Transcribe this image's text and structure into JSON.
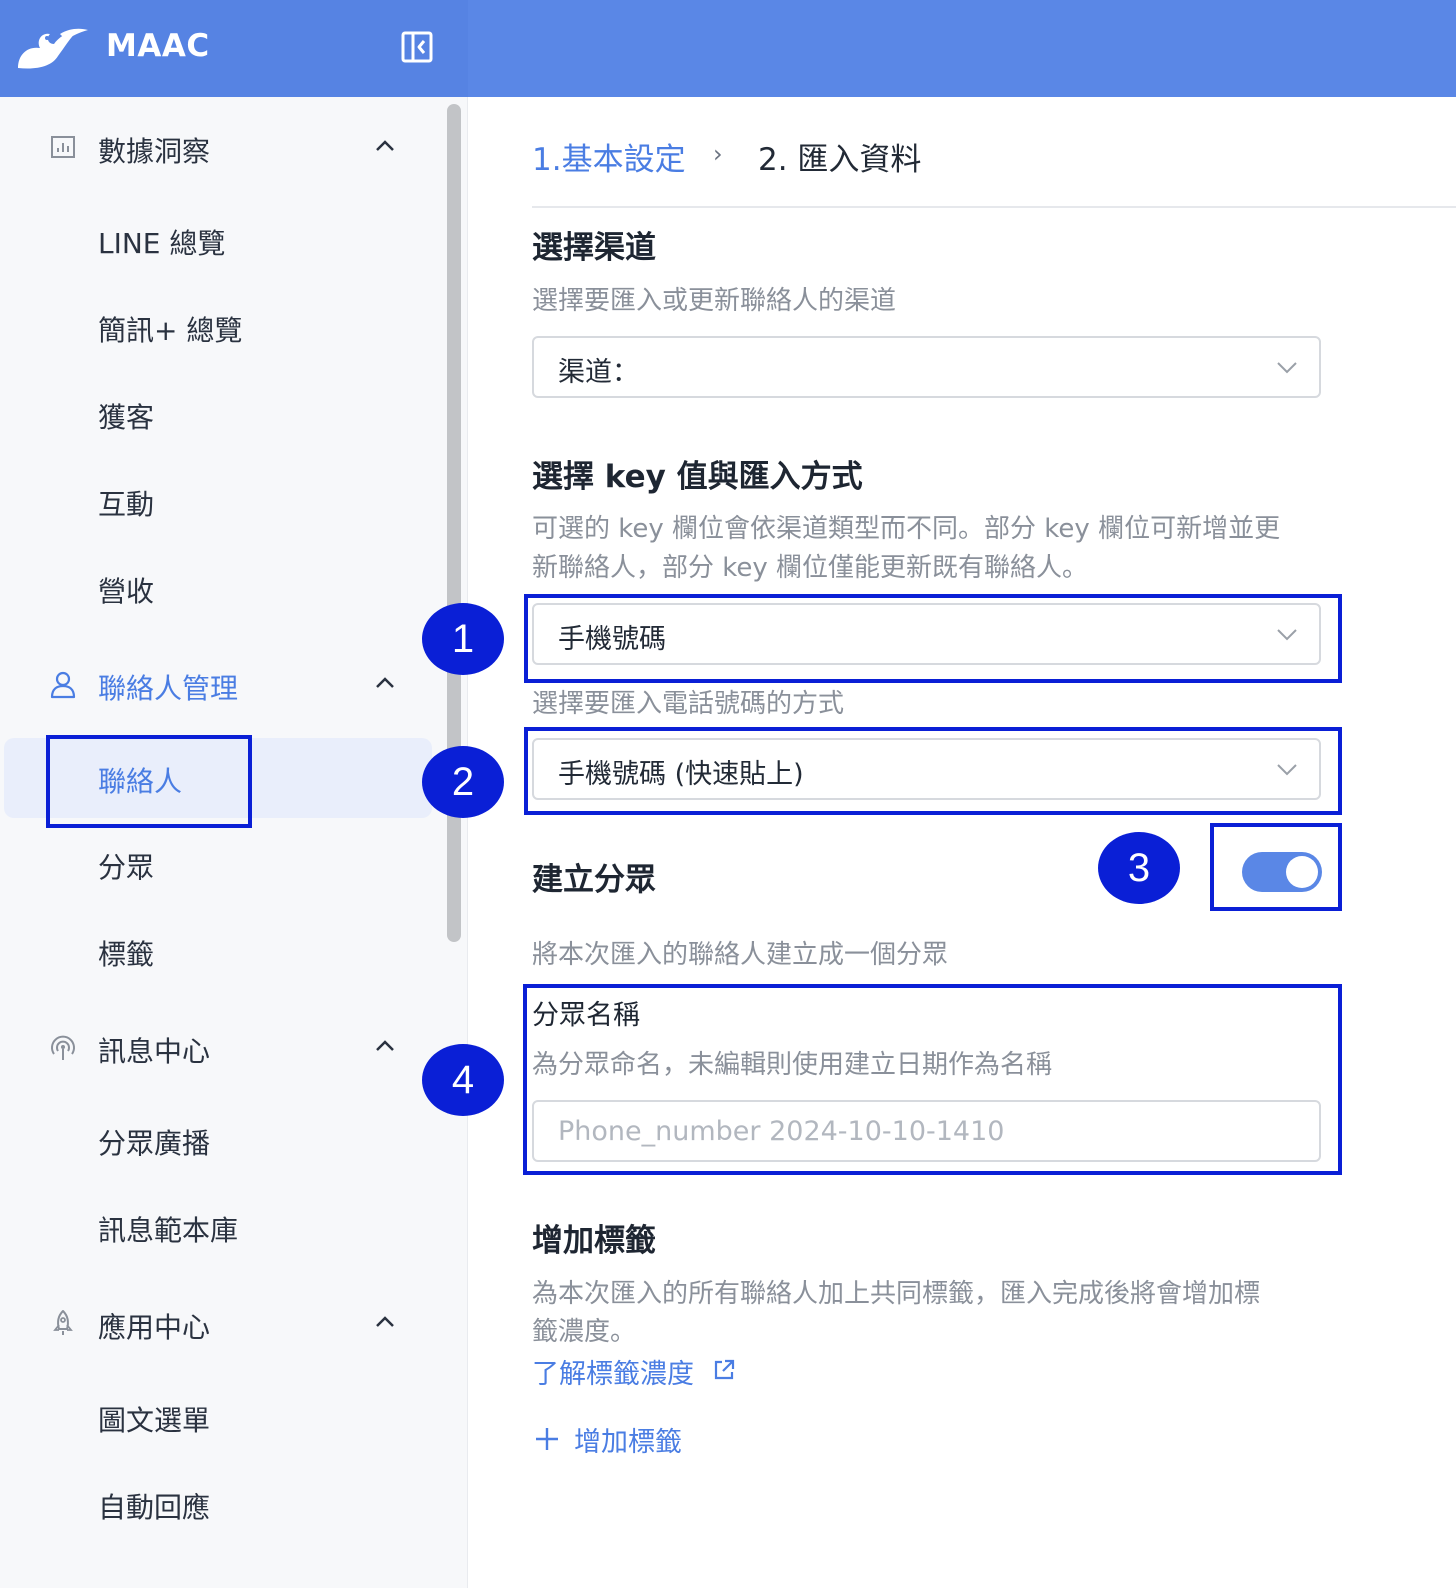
{
  "app": {
    "brand": "MAAC"
  },
  "sidebar": {
    "groups": [
      {
        "label": "數據洞察",
        "icon": "bar-chart-icon"
      },
      {
        "label": "聯絡人管理",
        "icon": "user-icon"
      },
      {
        "label": "訊息中心",
        "icon": "broadcast-icon"
      },
      {
        "label": "應用中心",
        "icon": "rocket-icon"
      }
    ],
    "items": [
      {
        "label": "LINE 總覽"
      },
      {
        "label": "簡訊+ 總覽"
      },
      {
        "label": "獲客"
      },
      {
        "label": "互動"
      },
      {
        "label": "營收"
      },
      {
        "label": "聯絡人"
      },
      {
        "label": "分眾"
      },
      {
        "label": "標籤"
      },
      {
        "label": "分眾廣播"
      },
      {
        "label": "訊息範本庫"
      },
      {
        "label": "圖文選單"
      },
      {
        "label": "自動回應"
      }
    ]
  },
  "steps": {
    "step1": "1.基本設定",
    "separator": "›",
    "step2": "2. 匯入資料"
  },
  "channel": {
    "title": "選擇渠道",
    "desc": "選擇要匯入或更新聯絡人的渠道",
    "select_value": "渠道："
  },
  "key": {
    "title": "選擇 key 值與匯入方式",
    "desc_line1": "可選的 key 欄位會依渠道類型而不同。部分 key 欄位可新增並更",
    "desc_line2": "新聯絡人，部分 key 欄位僅能更新既有聯絡人。",
    "select_value": "手機號碼",
    "method_label": "選擇要匯入電話號碼的方式",
    "method_value": "手機號碼 (快速貼上)"
  },
  "segment": {
    "title": "建立分眾",
    "toggle_on": true,
    "desc": "將本次匯入的聯絡人建立成一個分眾",
    "name_label": "分眾名稱",
    "name_hint": "為分眾命名，未編輯則使用建立日期作為名稱",
    "name_placeholder": "Phone_number 2024-10-10-1410"
  },
  "tags": {
    "title": "增加標籤",
    "desc_line1": "為本次匯入的所有聯絡人加上共同標籤，匯入完成後將會增加標",
    "desc_line2": "籤濃度。",
    "learn_link": "了解標籤濃度",
    "add_label": "增加標籤"
  },
  "annotations": [
    "1",
    "2",
    "3",
    "4"
  ],
  "colors": {
    "header": "#5a87e6",
    "accent": "#4a7de3",
    "annotation": "#0a1fd6",
    "selected_bg": "#e9eefb"
  }
}
